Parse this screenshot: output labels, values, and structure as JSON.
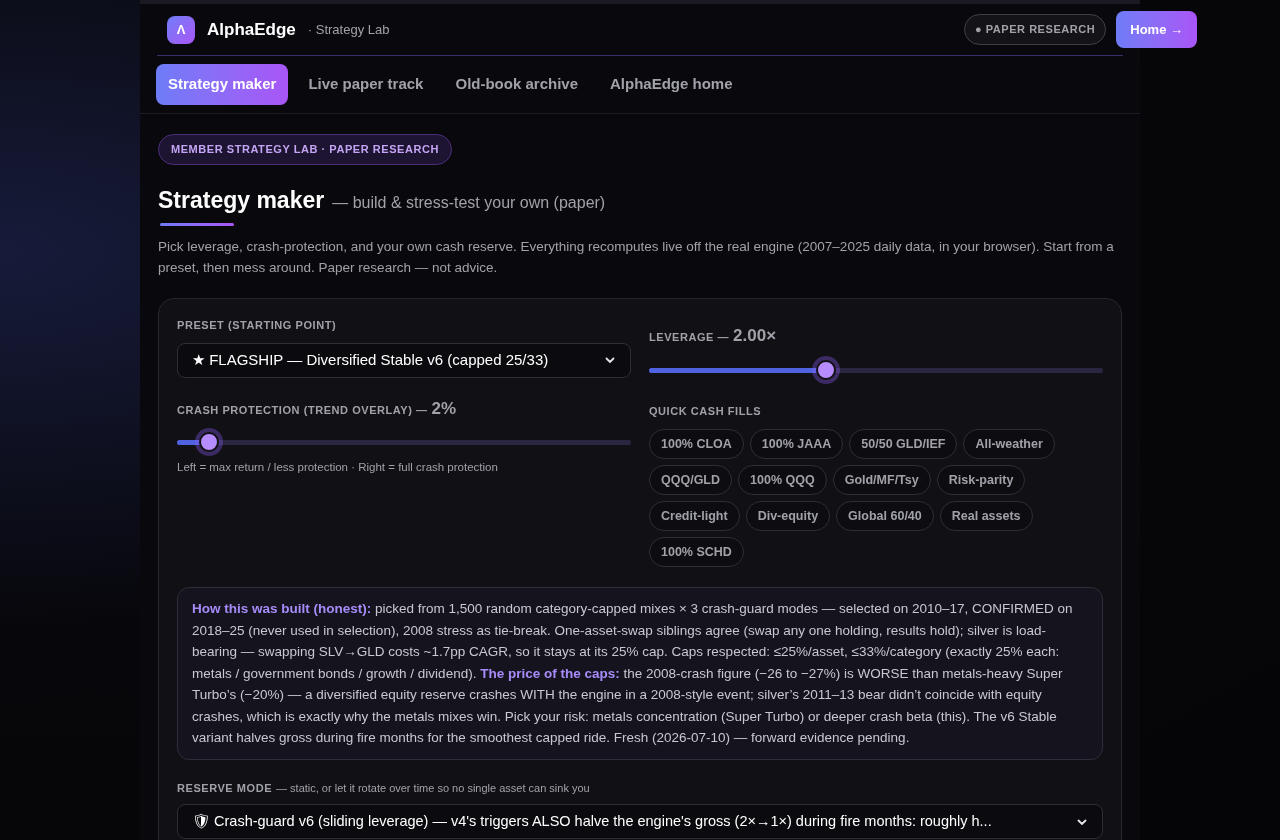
{
  "header": {
    "logo_letter": "Λ",
    "brand": "AlphaEdge",
    "subtitle": "· Strategy Lab",
    "status_badge": "● PAPER RESEARCH",
    "home_button": "Home →"
  },
  "nav": [
    {
      "label": "Strategy maker",
      "selected": true
    },
    {
      "label": "Live paper track",
      "selected": false
    },
    {
      "label": "Old-book archive",
      "selected": false
    },
    {
      "label": "AlphaEdge home",
      "selected": false
    }
  ],
  "eyebrow": "MEMBER STRATEGY LAB · PAPER RESEARCH",
  "title": "Strategy maker",
  "title_suffix": "— build & stress-test your own (paper)",
  "intro": "Pick leverage, crash-protection, and your own cash reserve. Everything recomputes live off the real engine (2007–2025 daily data, in your browser). Start from a preset, then mess around. Paper research — not advice.",
  "preset": {
    "label": "PRESET (STARTING POINT)",
    "value": "★ FLAGSHIP — Diversified Stable v6 (capped 25/33)"
  },
  "crash_protection": {
    "label": "CRASH PROTECTION (TREND OVERLAY) —",
    "reading": "2%",
    "level": 0.07,
    "hint": "Left = max return / less protection · Right = full crash protection"
  },
  "leverage": {
    "label": "LEVERAGE —",
    "reading": "2.00×",
    "level": 0.39
  },
  "quick_cash_fills": {
    "label": "QUICK CASH FILLS",
    "chips": [
      "100% CLOA",
      "100% JAAA",
      "50/50 GLD/IEF",
      "All-weather",
      "QQQ/GLD",
      "100% QQQ",
      "Gold/MF/Tsy",
      "Risk-parity",
      "Credit-light",
      "Div-equity",
      "Global 60/40",
      "Real assets",
      "100% SCHD"
    ]
  },
  "note": "**How this was built (honest):** picked from 1,500 random category-capped mixes × 3 crash-guard modes — selected on 2010–17, CONFIRMED on 2018–25 (never used in selection), 2008 stress as tie-break. One-asset-swap siblings agree (swap any one holding, results hold); silver is load-bearing — swapping SLV→GLD costs ~1.7pp CAGR, so it stays at its 25% cap. Caps respected: ≤25%/asset, ≤33%/category (exactly 25% each: metals / government bonds / growth / dividend). **The price of the caps:** the 2008-crash figure (−26 to −27%) is WORSE than metals-heavy Super Turbo’s (−20%) — a diversified equity reserve crashes WITH the engine in a 2008-style event; silver’s 2011–13 bear didn’t coincide with equity crashes, which is exactly why the metals mixes win. Pick your risk: metals concentration (Super Turbo) or deeper crash beta (this). The v6 Stable variant halves gross during fire months for the smoothest capped ride. Fresh (2026-07-10) — forward evidence pending.",
  "reserve_mode": {
    "label": "RESERVE MODE",
    "hint": "— static, or let it rotate over time so no single asset can sink you",
    "value": "🛡 Crash-guard v6 (sliding leverage) — v4's triggers ALSO halve the engine's gross (2×→1×) during fire months: roughly h..."
  }
}
